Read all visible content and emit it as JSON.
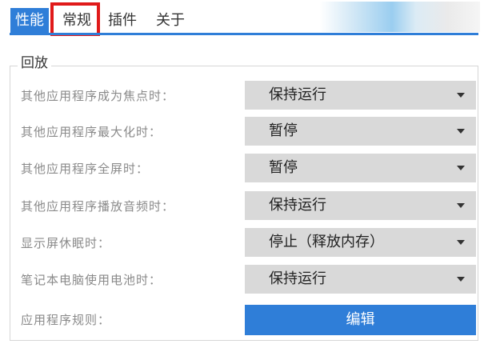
{
  "tabs": [
    {
      "label": "性能",
      "active": true
    },
    {
      "label": "常规",
      "active": false
    },
    {
      "label": "插件",
      "active": false
    },
    {
      "label": "关于",
      "active": false
    }
  ],
  "colors": {
    "accent": "#2f7ed8",
    "highlight": "#e01a1a",
    "select_bg": "#d9d9d9",
    "label_text": "#8a8a8a"
  },
  "playback": {
    "title": "回放",
    "rows": [
      {
        "label": "其他应用程序成为焦点时：",
        "value": "保持运行"
      },
      {
        "label": "其他应用程序最大化时：",
        "value": "暂停"
      },
      {
        "label": "其他应用程序全屏时：",
        "value": "暂停"
      },
      {
        "label": "其他应用程序播放音频时：",
        "value": "保持运行"
      },
      {
        "label": "显示屏休眠时：",
        "value": "停止（释放内存）"
      },
      {
        "label": "笔记本电脑使用电池时：",
        "value": "保持运行"
      }
    ],
    "rules": {
      "label": "应用程序规则：",
      "button": "编辑"
    }
  }
}
